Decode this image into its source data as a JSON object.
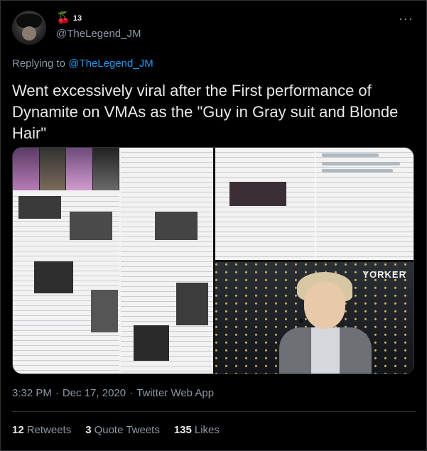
{
  "author": {
    "display_name": "13",
    "handle": "@TheLegend_JM",
    "badge_icon": "cherry-icon"
  },
  "more_icon": "···",
  "reply": {
    "prefix": "Replying to",
    "mention": "@TheLegend_JM"
  },
  "tweet_text": "Went excessively viral after the First performance of Dynamite on VMAs as the \"Guy in Gray suit and Blonde Hair\"",
  "media": {
    "overlay_label": "YORKER"
  },
  "meta": {
    "time": "3:32 PM",
    "sep1": "·",
    "date": "Dec 17, 2020",
    "sep2": "·",
    "source": "Twitter Web App"
  },
  "stats": {
    "retweets_count": "12",
    "retweets_label": "Retweets",
    "quotes_count": "3",
    "quotes_label": "Quote Tweets",
    "likes_count": "135",
    "likes_label": "Likes"
  },
  "colors": {
    "background": "#000000",
    "accent": "#1d9bf0",
    "secondary_text": "#8b98a5",
    "primary_text": "#e7e9ea"
  }
}
